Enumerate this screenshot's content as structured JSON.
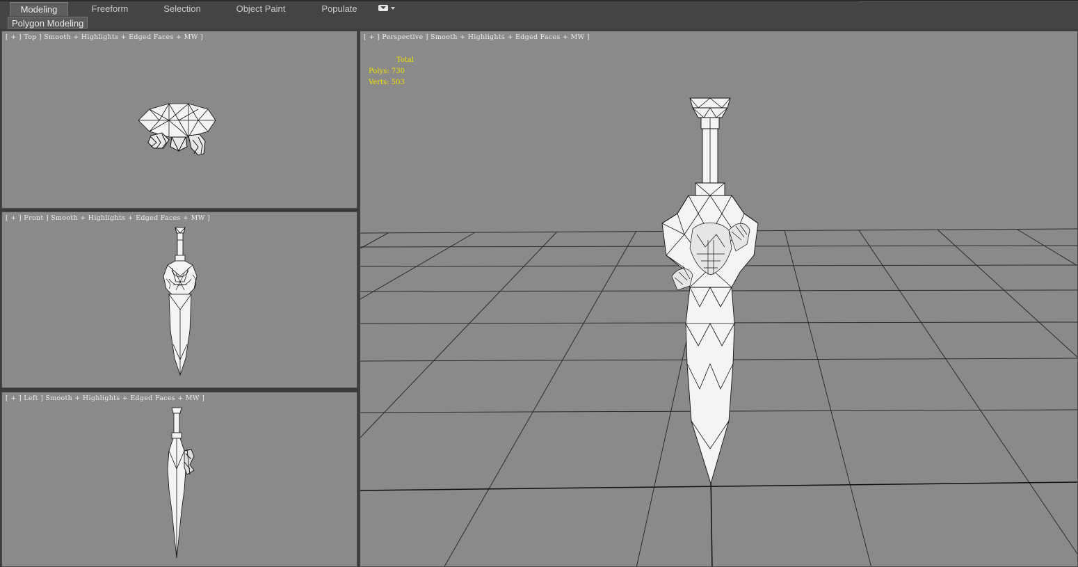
{
  "ribbon": {
    "tabs": [
      {
        "label": "Modeling",
        "active": true
      },
      {
        "label": "Freeform",
        "active": false
      },
      {
        "label": "Selection",
        "active": false
      },
      {
        "label": "Object Paint",
        "active": false
      },
      {
        "label": "Populate",
        "active": false
      }
    ],
    "panel_label": "Polygon Modeling"
  },
  "viewports": {
    "top": {
      "label": "[ + ] Top ] Smooth + Highlights + Edged Faces + MW ]"
    },
    "front": {
      "label": "[ + ] Front ] Smooth + Highlights + Edged Faces + MW ]"
    },
    "left": {
      "label": "[ + ] Left ] Smooth + Highlights + Edged Faces + MW ]"
    },
    "perspective": {
      "label": "[ + ] Perspective ] Smooth + Highlights + Edged Faces + MW ]"
    }
  },
  "stats": {
    "header": "Total",
    "polys_label": "Polys:",
    "polys_value": "730",
    "verts_label": "Verts:",
    "verts_value": "503"
  },
  "colors": {
    "viewport_bg": "#8a8a8a",
    "stats_text": "#f2e200",
    "mesh_fill": "#f4f4f4",
    "wire": "#111111"
  }
}
